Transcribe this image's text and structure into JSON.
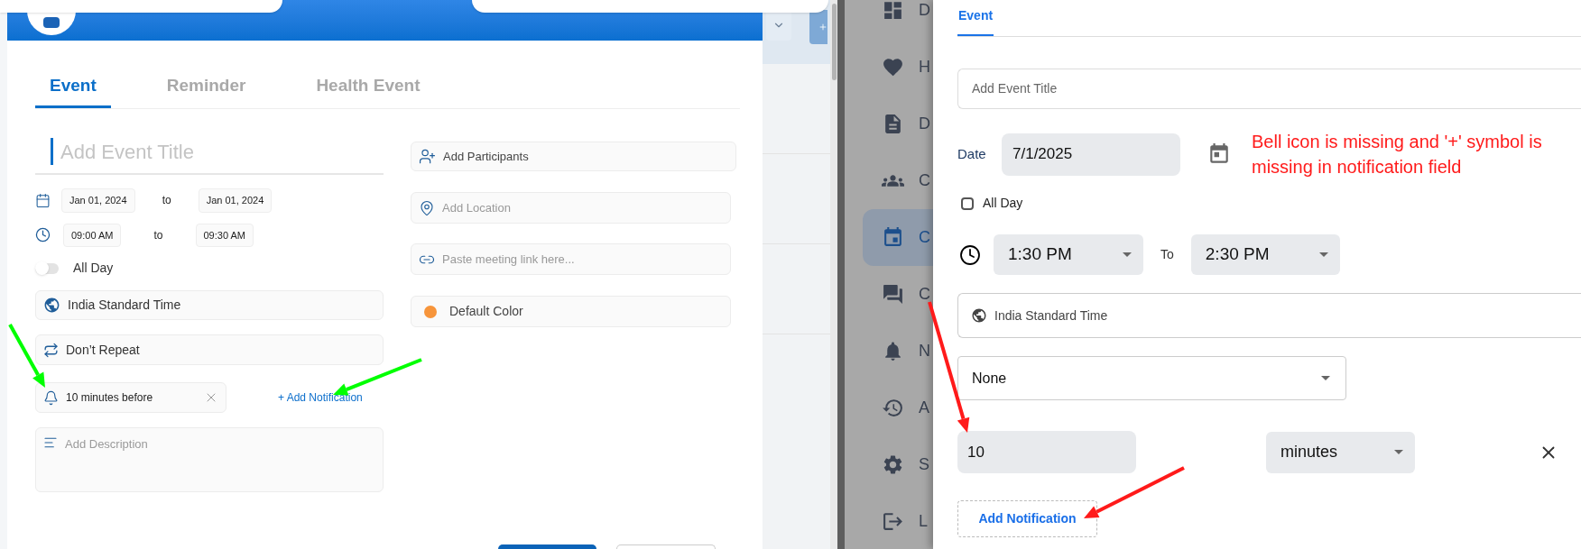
{
  "create_event": {
    "tabs": [
      {
        "label": "Event",
        "selected": true
      },
      {
        "label": "Reminder",
        "selected": false
      },
      {
        "label": "Health Event",
        "selected": false
      }
    ],
    "title_placeholder": "Add Event Title",
    "date": {
      "start": "Jan 01, 2024",
      "separator": "to",
      "end": "Jan 01, 2024"
    },
    "time": {
      "start": "09:00 AM",
      "separator": "to",
      "end": "09:30 AM"
    },
    "all_day": {
      "label": "All Day",
      "on": false
    },
    "timezone": "India Standard Time",
    "repeat": "Don’t Repeat",
    "notification": {
      "value": "10 minutes before",
      "add_link": "+ Add Notification"
    },
    "description_placeholder": "Add Description",
    "participants_placeholder": "Add Participants",
    "location_placeholder": "Add Location",
    "meeting_link_placeholder": "Paste meeting link here...",
    "color_label": "Default Color"
  },
  "event_form": {
    "sidebar": [
      {
        "label": "D",
        "selected": false
      },
      {
        "label": "H",
        "selected": false
      },
      {
        "label": "D",
        "selected": false
      },
      {
        "label": "C",
        "selected": false
      },
      {
        "label": "C",
        "selected": true
      },
      {
        "label": "C",
        "selected": false
      },
      {
        "label": "N",
        "selected": false
      },
      {
        "label": "A",
        "selected": false
      },
      {
        "label": "S",
        "selected": false
      },
      {
        "label": "L",
        "selected": false
      }
    ],
    "tabs": [
      {
        "label": "Event",
        "selected": true
      }
    ],
    "title_placeholder": "Add Event Title",
    "date": {
      "label": "Date",
      "value": "7/1/2025"
    },
    "all_day": {
      "label": "All Day",
      "checked": false
    },
    "time": {
      "start": "1:30 PM",
      "separator": "To",
      "end": "2:30 PM"
    },
    "timezone": "India Standard Time",
    "repeat": "None",
    "notification": {
      "amount": "10",
      "unit": "minutes"
    },
    "add_notification": "Add Notification"
  },
  "annotation": "Bell icon is missing and '+' symbol is missing in notification field"
}
